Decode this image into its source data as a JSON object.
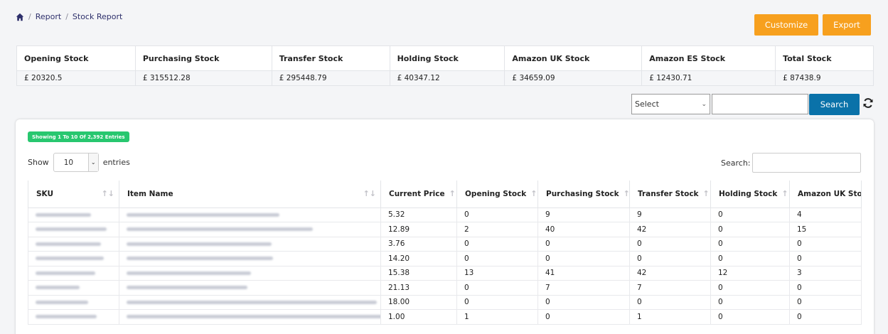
{
  "breadcrumb": {
    "home_icon": "home-icon",
    "items": [
      "Report",
      "Stock Report"
    ],
    "separator": "/"
  },
  "actions": {
    "customize_label": "Customize",
    "export_label": "Export",
    "color": "#f7a01e"
  },
  "summary": {
    "headers": [
      "Opening Stock",
      "Purchasing Stock",
      "Transfer Stock",
      "Holding Stock",
      "Amazon UK Stock",
      "Amazon ES Stock",
      "Total Stock"
    ],
    "values": [
      "£ 20320.5",
      "£ 315512.28",
      "£ 295448.79",
      "£ 40347.12",
      "£ 34659.09",
      "£ 12430.71",
      "£ 87438.9"
    ]
  },
  "filter": {
    "select_value": "Select",
    "search_value": "",
    "search_label": "Search",
    "refresh_icon": "refresh-icon",
    "button_color": "#0a72a9"
  },
  "table": {
    "info_badge": "Showing 1 To 10 Of 2,392 Entries",
    "show_label": "Show",
    "page_length": "10",
    "entries_label": "entries",
    "search_label": "Search:",
    "search_value": "",
    "columns": [
      "SKU",
      "Item Name",
      "Current Price",
      "Opening Stock",
      "Purchasing Stock",
      "Transfer Stock",
      "Holding Stock",
      "Amazon UK Stock"
    ],
    "rows": [
      {
        "price": "5.32",
        "opening": "0",
        "purchasing": "9",
        "transfer": "9",
        "holding": "0",
        "amazon_uk": "4"
      },
      {
        "price": "12.89",
        "opening": "2",
        "purchasing": "40",
        "transfer": "42",
        "holding": "0",
        "amazon_uk": "15"
      },
      {
        "price": "3.76",
        "opening": "0",
        "purchasing": "0",
        "transfer": "0",
        "holding": "0",
        "amazon_uk": "0"
      },
      {
        "price": "14.20",
        "opening": "0",
        "purchasing": "0",
        "transfer": "0",
        "holding": "0",
        "amazon_uk": "0"
      },
      {
        "price": "15.38",
        "opening": "13",
        "purchasing": "41",
        "transfer": "42",
        "holding": "12",
        "amazon_uk": "3"
      },
      {
        "price": "21.13",
        "opening": "0",
        "purchasing": "7",
        "transfer": "7",
        "holding": "0",
        "amazon_uk": "0"
      },
      {
        "price": "18.00",
        "opening": "0",
        "purchasing": "0",
        "transfer": "0",
        "holding": "0",
        "amazon_uk": "0"
      },
      {
        "price": "1.00",
        "opening": "1",
        "purchasing": "0",
        "transfer": "1",
        "holding": "0",
        "amazon_uk": "0"
      }
    ],
    "badge_color": "#28c76f"
  }
}
